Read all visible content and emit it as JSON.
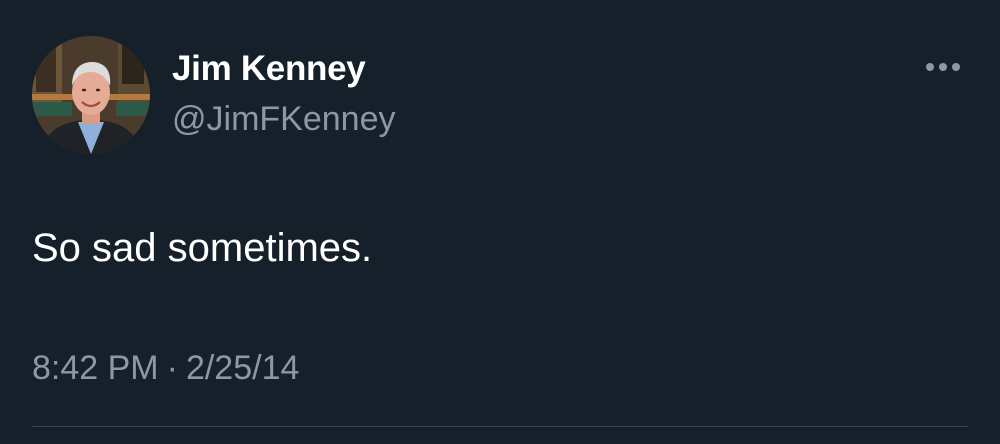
{
  "tweet": {
    "author": {
      "display_name": "Jim Kenney",
      "handle": "@JimFKenney",
      "avatar_icon": "profile-photo-avatar"
    },
    "text": "So sad sometimes.",
    "time": "8:42 PM",
    "separator": "·",
    "date": "2/25/14",
    "more_icon": "more-horizontal-icon"
  },
  "colors": {
    "background": "#15202b",
    "primary_text": "#ffffff",
    "secondary_text": "#8b98a5",
    "divider": "#38444d"
  }
}
